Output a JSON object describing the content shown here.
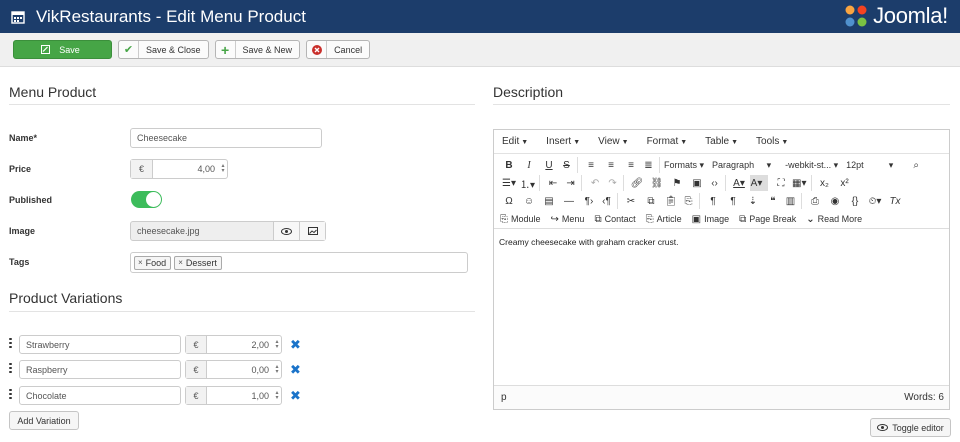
{
  "header": {
    "title": "VikRestaurants - Edit Menu Product",
    "logo_text": "Joomla!"
  },
  "toolbar": {
    "save_label": "Save",
    "save_close_label": "Save & Close",
    "save_new_label": "Save & New",
    "cancel_label": "Cancel"
  },
  "menu_product": {
    "section_title": "Menu Product",
    "name_label": "Name*",
    "name_value": "Cheesecake",
    "price_label": "Price",
    "currency": "€",
    "price_value": "4,00",
    "published_label": "Published",
    "published": true,
    "image_label": "Image",
    "image_value": "cheesecake.jpg",
    "tags_label": "Tags",
    "tags": [
      "Food",
      "Dessert"
    ]
  },
  "variations": {
    "section_title": "Product Variations",
    "currency": "€",
    "items": [
      {
        "name": "Strawberry",
        "price": "2,00"
      },
      {
        "name": "Raspberry",
        "price": "0,00"
      },
      {
        "name": "Chocolate",
        "price": "1,00"
      }
    ],
    "add_label": "Add Variation"
  },
  "description": {
    "section_title": "Description",
    "menus": [
      "Edit",
      "Insert",
      "View",
      "Format",
      "Table",
      "Tools"
    ],
    "formats_label": "Formats",
    "block_label": "Paragraph",
    "font_label": "-webkit-st...",
    "size_label": "12pt",
    "insert_buttons": [
      "Module",
      "Menu",
      "Contact",
      "Article",
      "Image",
      "Page Break",
      "Read More"
    ],
    "content": "Creamy cheesecake with graham cracker crust.",
    "path": "p",
    "words": "Words: 6",
    "toggle_label": "Toggle editor"
  },
  "colors": {
    "header_bg": "#1c3d6b",
    "save_green": "#46a546",
    "toggle_green": "#3cbc5b",
    "remove_blue": "#1a73c9"
  }
}
